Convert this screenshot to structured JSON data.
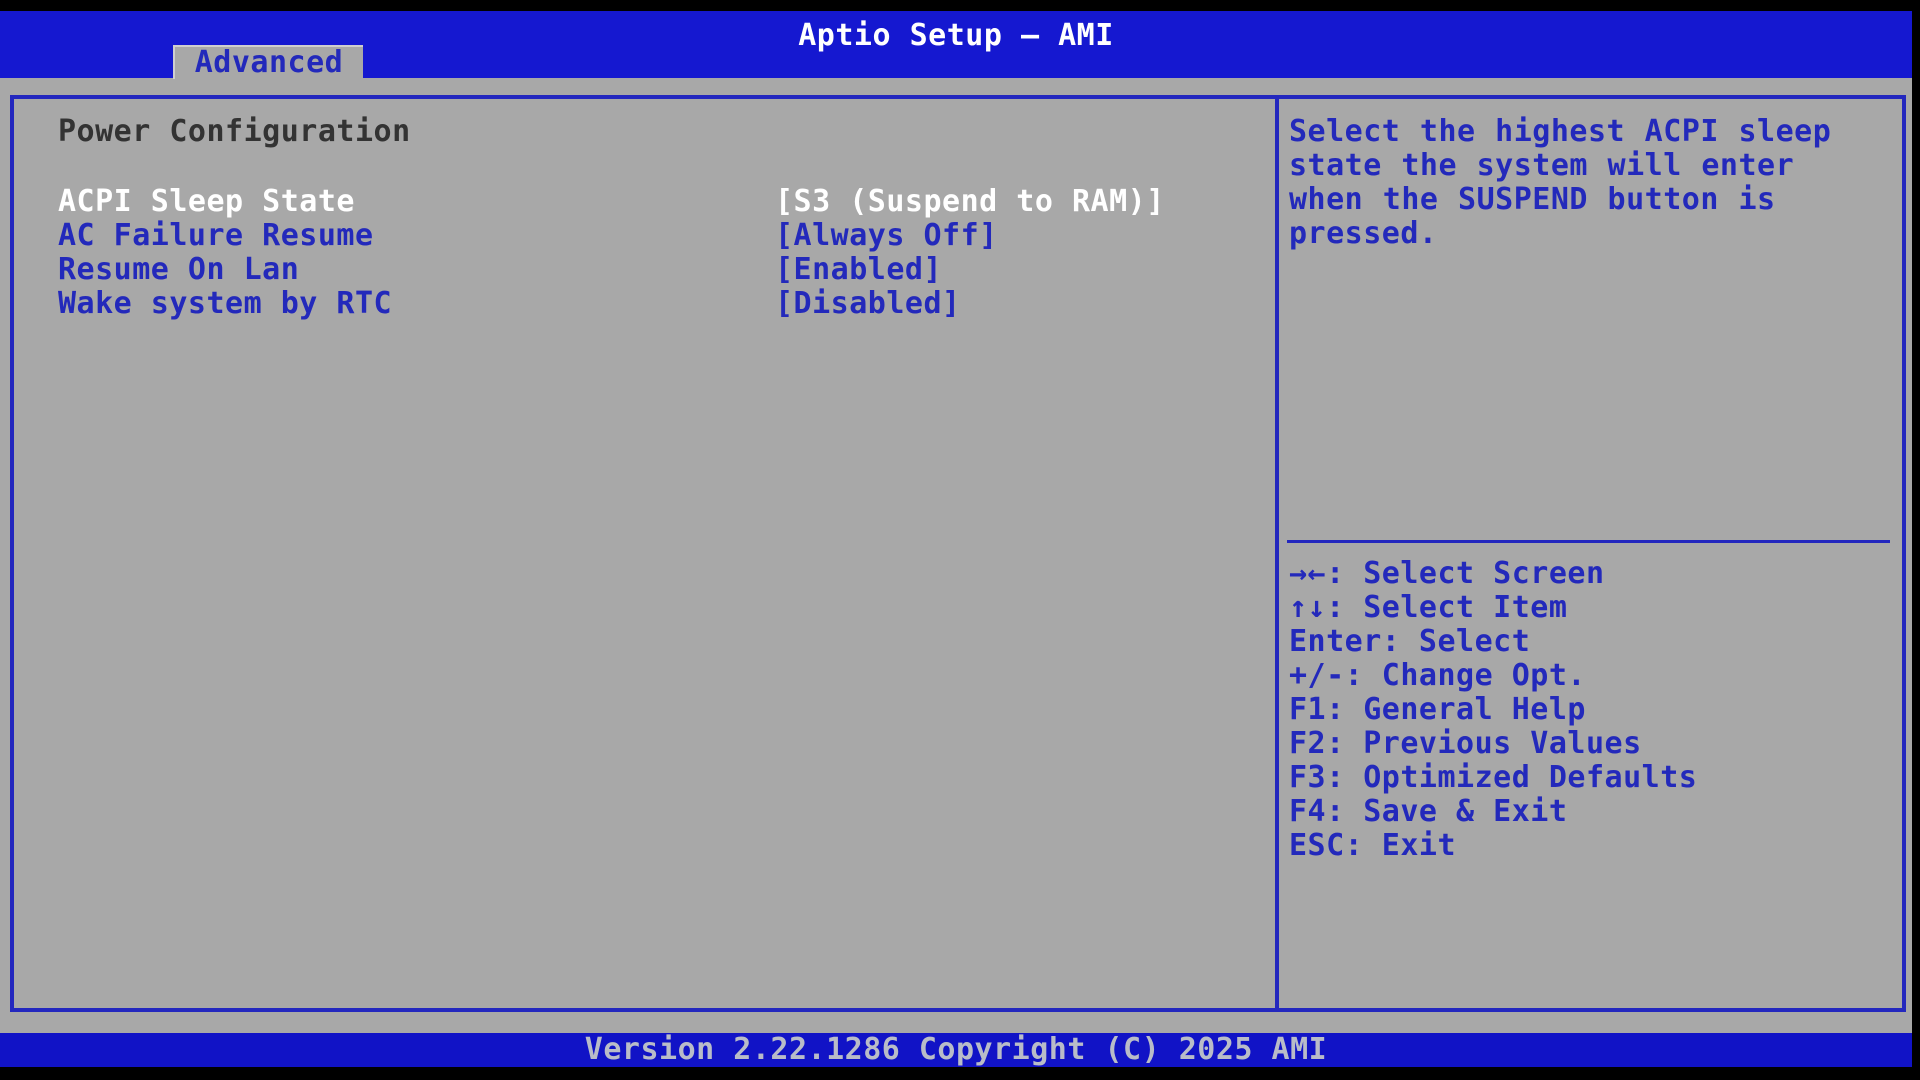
{
  "header": {
    "title": "Aptio Setup – AMI"
  },
  "tabs": [
    {
      "label": "Advanced",
      "active": true
    }
  ],
  "main": {
    "section_title": "Power Configuration",
    "items": [
      {
        "label": "ACPI Sleep State",
        "value": "[S3 (Suspend to RAM)]",
        "selected": true
      },
      {
        "label": "AC Failure Resume",
        "value": "[Always Off]",
        "selected": false
      },
      {
        "label": "Resume On Lan",
        "value": "[Enabled]",
        "selected": false
      },
      {
        "label": "Wake system by RTC",
        "value": "[Disabled]",
        "selected": false
      }
    ]
  },
  "help": {
    "text": "Select the highest ACPI sleep state the system will enter when the SUSPEND button is pressed."
  },
  "legend": [
    "→←: Select Screen",
    "↑↓: Select Item",
    "Enter: Select",
    "+/-: Change Opt.",
    "F1: General Help",
    "F2: Previous Values",
    "F3: Optimized Defaults",
    "F4: Save & Exit",
    "ESC: Exit"
  ],
  "footer": {
    "version_text": "Version 2.22.1286 Copyright (C) 2025 AMI"
  },
  "colors": {
    "header_bg": "#1518d0",
    "footer_bg": "#1113c6",
    "panel_bg": "#a8a8a8",
    "border_blue": "#2327be",
    "text_blue": "#2329bb",
    "text_white": "#ffffff",
    "text_dark": "#333333",
    "footer_text": "#b9bcc8",
    "tab_edge": "#cfcfcf",
    "screen_black": "#000000"
  }
}
